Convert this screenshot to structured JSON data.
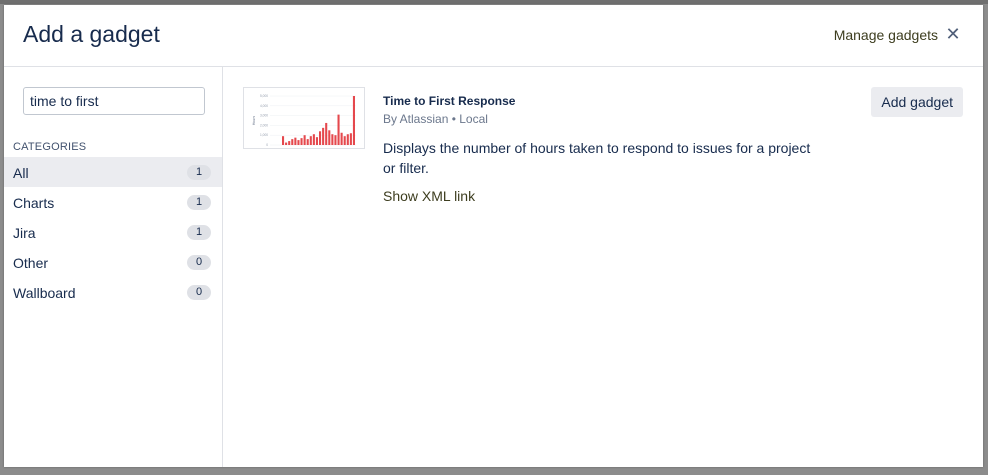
{
  "dialog": {
    "title": "Add a gadget",
    "manage_label": "Manage gadgets",
    "close_glyph": "✕"
  },
  "sidebar": {
    "search": {
      "value": "time to first"
    },
    "categories_heading": "CATEGORIES",
    "categories": [
      {
        "label": "All",
        "count": "1",
        "selected": true
      },
      {
        "label": "Charts",
        "count": "1",
        "selected": false
      },
      {
        "label": "Jira",
        "count": "1",
        "selected": false
      },
      {
        "label": "Other",
        "count": "0",
        "selected": false
      },
      {
        "label": "Wallboard",
        "count": "0",
        "selected": false
      }
    ]
  },
  "gadget": {
    "title": "Time to First Response",
    "author": "By Atlassian • Local",
    "description": "Displays the number of hours taken to respond to issues for a project or filter.",
    "xml_link": "Show XML link",
    "add_label": "Add gadget",
    "thumbnail": {
      "bar_color": "#e5484d",
      "y_ticks": [
        "5,000",
        "4,000",
        "3,000",
        "2,000",
        "1,000",
        "0"
      ],
      "y_label": "Hours",
      "bars": [
        0.18,
        0.05,
        0.08,
        0.12,
        0.15,
        0.1,
        0.14,
        0.2,
        0.12,
        0.18,
        0.22,
        0.16,
        0.28,
        0.35,
        0.45,
        0.3,
        0.22,
        0.2,
        0.62,
        0.25,
        0.18,
        0.22,
        0.24,
        1.0
      ]
    }
  },
  "colors": {
    "link": "#3d3d1f",
    "text": "#172b4d",
    "selected_bg": "#ebecf0"
  }
}
